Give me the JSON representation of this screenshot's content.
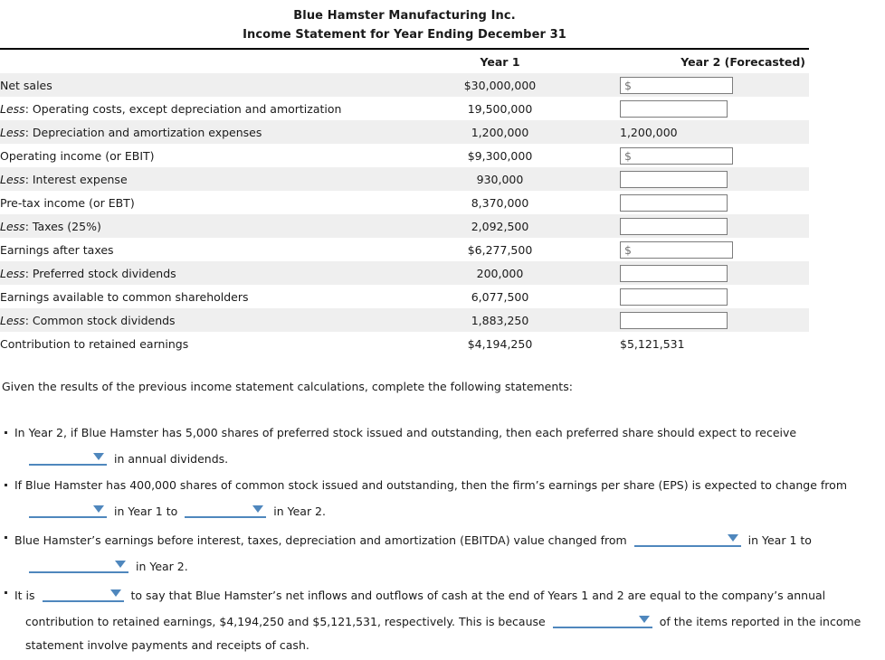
{
  "statement": {
    "company_title": "Blue Hamster Manufacturing Inc.",
    "subtitle": "Income Statement for Year Ending December 31",
    "columns": {
      "label": "",
      "year1": "Year 1",
      "year2": "Year 2  (Forecasted)"
    },
    "rows": [
      {
        "label_prefix": "",
        "label": "Net sales",
        "year1": "$30,000,000",
        "year2_type": "input",
        "year2_placeholder": "$",
        "year2_value": "",
        "shaded": true
      },
      {
        "label_prefix": "Less",
        "label": ": Operating costs, except depreciation and amortization",
        "year1": "19,500,000",
        "year2_type": "input",
        "year2_placeholder": "",
        "year2_value": "",
        "shaded": false
      },
      {
        "label_prefix": "Less",
        "label": ": Depreciation and amortization expenses",
        "year1": "1,200,000",
        "year2_type": "static",
        "year2_value": "1,200,000",
        "shaded": true
      },
      {
        "label_prefix": "",
        "label": "Operating income (or EBIT)",
        "year1": "$9,300,000",
        "year2_type": "input",
        "year2_placeholder": "$",
        "year2_value": "",
        "shaded": false
      },
      {
        "label_prefix": "Less",
        "label": ": Interest expense",
        "year1": "930,000",
        "year2_type": "input",
        "year2_placeholder": "",
        "year2_value": "",
        "shaded": true
      },
      {
        "label_prefix": "",
        "label": "Pre-tax income (or EBT)",
        "year1": "8,370,000",
        "year2_type": "input",
        "year2_placeholder": "",
        "year2_value": "",
        "shaded": false
      },
      {
        "label_prefix": "Less",
        "label": ": Taxes (25%)",
        "year1": "2,092,500",
        "year2_type": "input",
        "year2_placeholder": "",
        "year2_value": "",
        "shaded": true
      },
      {
        "label_prefix": "",
        "label": "Earnings after taxes",
        "year1": "$6,277,500",
        "year2_type": "input",
        "year2_placeholder": "$",
        "year2_value": "",
        "shaded": false
      },
      {
        "label_prefix": "Less",
        "label": ": Preferred stock dividends",
        "year1": "200,000",
        "year2_type": "input",
        "year2_placeholder": "",
        "year2_value": "",
        "shaded": true
      },
      {
        "label_prefix": "",
        "label": "Earnings available to common shareholders",
        "year1": "6,077,500",
        "year2_type": "input",
        "year2_placeholder": "",
        "year2_value": "",
        "shaded": false
      },
      {
        "label_prefix": "Less",
        "label": ": Common stock dividends",
        "year1": "1,883,250",
        "year2_type": "input",
        "year2_placeholder": "",
        "year2_value": "",
        "shaded": true
      },
      {
        "label_prefix": "",
        "label": "Contribution to retained earnings",
        "year1": "$4,194,250",
        "year2_type": "static",
        "year2_value": "$5,121,531",
        "shaded": false
      }
    ]
  },
  "prompt": "Given the results of the previous income statement calculations, complete the following statements:",
  "bullets": {
    "b1": {
      "part1": "In Year 2, if Blue Hamster has 5,000 shares of preferred stock issued and outstanding, then each preferred share should expect to receive",
      "dropdown1": "",
      "part2": "in annual dividends."
    },
    "b2": {
      "part1": "If Blue Hamster has 400,000 shares of common stock issued and outstanding, then the firm’s earnings per share (EPS) is expected to change from",
      "dropdown1": "",
      "part2": "in Year 1 to",
      "dropdown2": "",
      "part3": "in Year 2."
    },
    "b3": {
      "part1": "Blue Hamster’s earnings before interest, taxes, depreciation and amortization (EBITDA) value changed from",
      "dropdown1": "",
      "part2": "in Year 1 to",
      "dropdown2": "",
      "part3": "in Year 2."
    },
    "b4": {
      "part1": "It is",
      "dropdown1": "",
      "part2": "to say that Blue Hamster’s net inflows and outflows of cash at the end of Years 1 and 2 are equal to the company’s annual",
      "part3": "contribution to retained earnings, $4,194,250 and $5,121,531, respectively. This is because",
      "dropdown2": "",
      "part4": "of the items reported in the income",
      "part5": "statement involve payments and receipts of cash."
    }
  },
  "colors": {
    "accent_blue": "#4f87bd",
    "row_shade": "#efefef",
    "rule": "#000000",
    "input_border": "#7c7c7c",
    "placeholder": "#9a9a9a"
  }
}
